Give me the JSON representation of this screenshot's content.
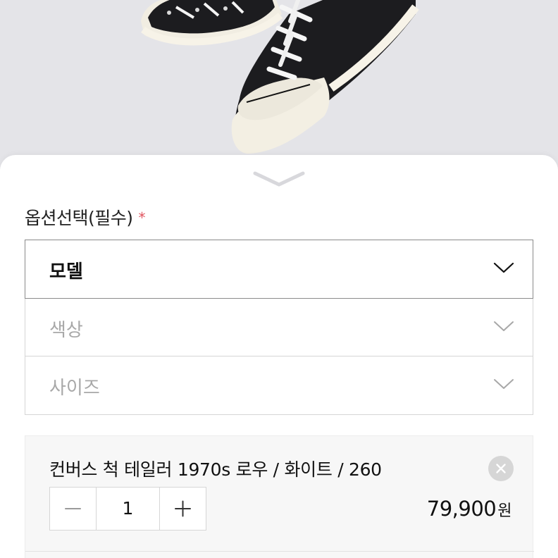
{
  "option_section": {
    "label": "옵션선택(필수)",
    "required_mark": "*",
    "required_color": "#e0535e"
  },
  "selects": [
    {
      "label": "모델",
      "state": "active"
    },
    {
      "label": "색상",
      "state": "disabled"
    },
    {
      "label": "사이즈",
      "state": "disabled"
    }
  ],
  "cart_item": {
    "title": "컨버스 척 테일러 1970s 로우 / 화이트 / 260",
    "quantity": "1",
    "price": "79,900",
    "currency": "원"
  },
  "icons": {
    "sheet_handle": "chevron-down-icon",
    "select_chevron": "chevron-down-icon",
    "remove": "close-icon",
    "decrement": "minus-icon",
    "increment": "plus-icon"
  }
}
